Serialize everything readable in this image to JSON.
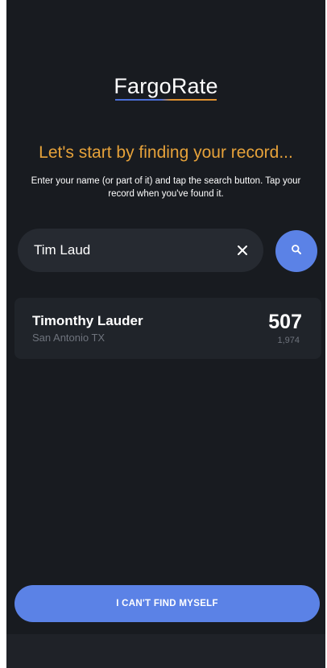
{
  "app": {
    "logo": "FargoRate",
    "accent_blue": "#5b82e6",
    "accent_orange": "#e6a23a",
    "background": "#181b20"
  },
  "intro": {
    "headline": "Let's start by finding your record...",
    "instructions": "Enter your name (or part of it) and tap the search button. Tap your record when you've found it."
  },
  "search": {
    "value": "Tim Laud",
    "clear_icon": "close-icon",
    "button_icon": "search-icon"
  },
  "results": [
    {
      "name": "Timonthy Lauder",
      "location": "San Antonio TX",
      "rating": "507",
      "count": "1,974"
    }
  ],
  "footer": {
    "cant_find_label": "I CAN'T FIND MYSELF"
  }
}
